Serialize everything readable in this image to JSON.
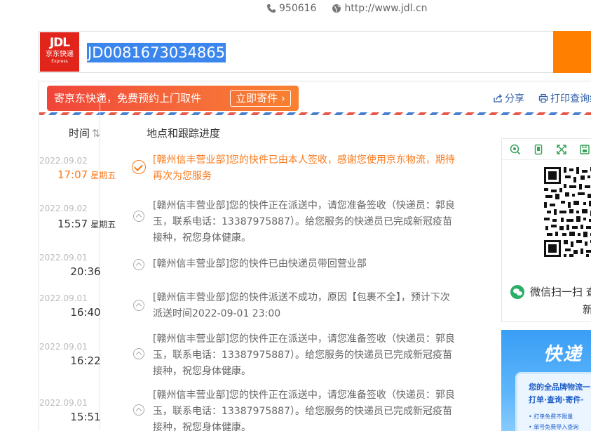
{
  "topbar": {
    "phone": "950616",
    "website": "http://www.jdl.cn"
  },
  "logo": {
    "brand": "JDL",
    "name_cn": "京东快递",
    "name_en": "Express"
  },
  "search": {
    "tracking_number": "JD0081673034865"
  },
  "promo": {
    "text": "寄京东快递，免费预约上门取件",
    "button": "立即寄件 ›"
  },
  "actions": {
    "share": "分享",
    "print": "打印查询结"
  },
  "table": {
    "col_time": "时间",
    "col_progress": "地点和跟踪进度"
  },
  "events": [
    {
      "date": "2022.09.02",
      "time": "17:07",
      "weekday": "星期五",
      "desc": "[赣州信丰营业部]您的快件已由本人签收，感谢您使用京东物流，期待再次为您服务"
    },
    {
      "date": "2022.09.02",
      "time": "15:57",
      "weekday": "星期五",
      "desc": "[赣州信丰营业部]您的快件正在派送中，请您准备签收（快递员：郭良玉，联系电话：13387975887）。给您服务的快递员已完成新冠疫苗接种，祝您身体健康。"
    },
    {
      "date": "2022.09.01",
      "time": "20:36",
      "weekday": "",
      "desc": "[赣州信丰营业部]您的快件已由快递员带回营业部"
    },
    {
      "date": "2022.09.01",
      "time": "16:40",
      "weekday": "",
      "desc": "[赣州信丰营业部]您的快件派送不成功，原因【包裹不全】，预计下次派送时间2022-09-01 23:00"
    },
    {
      "date": "2022.09.01",
      "time": "16:22",
      "weekday": "",
      "desc": "[赣州信丰营业部]您的快件正在派送中，请您准备签收（快递员：郭良玉，联系电话：13387975887）。给您服务的快递员已完成新冠疫苗接种，祝您身体健康。"
    },
    {
      "date": "2022.09.01",
      "time": "15:51",
      "weekday": "",
      "desc": "[赣州信丰营业部]您的快件正在派送中，请您准备签收（快递员：郭良玉，联系电话：13387975887）。给您服务的快递员已完成新冠疫苗接种，祝您身体健康。"
    }
  ],
  "qr": {
    "wechat_text": "微信扫一扫 查",
    "wechat_text2": "新"
  },
  "banner": {
    "title": "快递",
    "line1": "您的全品牌物流一",
    "line2": "打单·查询·寄件·",
    "line3": "• 打单免费不限量",
    "line4": "• 单号免费导入查询"
  },
  "colors": {
    "accent_orange": "#f97a1c",
    "link_blue": "#2e5ea8",
    "brand_red": "#e1251b",
    "selection_blue": "#3b86ed"
  }
}
